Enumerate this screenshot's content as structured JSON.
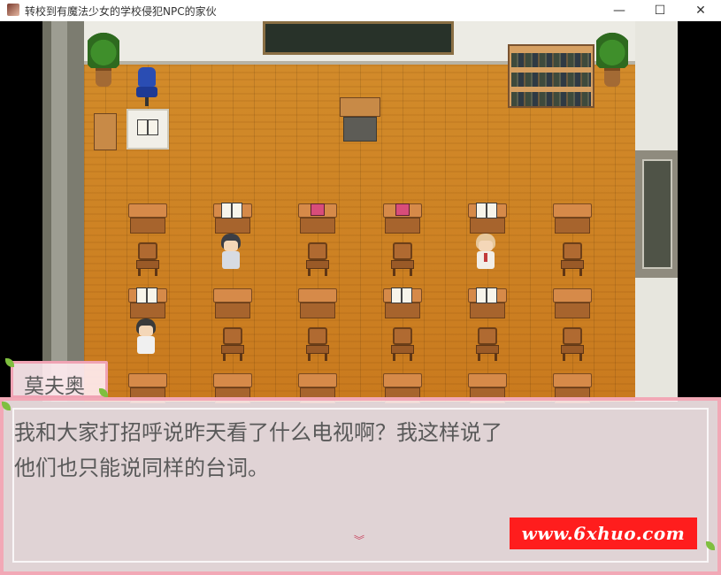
{
  "window": {
    "title": "转校到有魔法少女的学校侵犯NPC的家伙",
    "icon_name": "app-icon",
    "controls": {
      "minimize_label": "—",
      "maximize_label": "☐",
      "close_label": "✕"
    }
  },
  "dialogue": {
    "speaker": "莫夫奥",
    "lines": [
      "我和大家打招呼说昨天看了什么电视啊？我这样说了",
      "他们也只能说同样的台词。"
    ],
    "next_indicator": "︾"
  },
  "watermark": {
    "text": "www.6xhuo.com"
  },
  "colors": {
    "dialog_border": "#f2a8b6",
    "dialog_bg": "#fff0f3",
    "watermark_bg": "#ff1d1d"
  }
}
